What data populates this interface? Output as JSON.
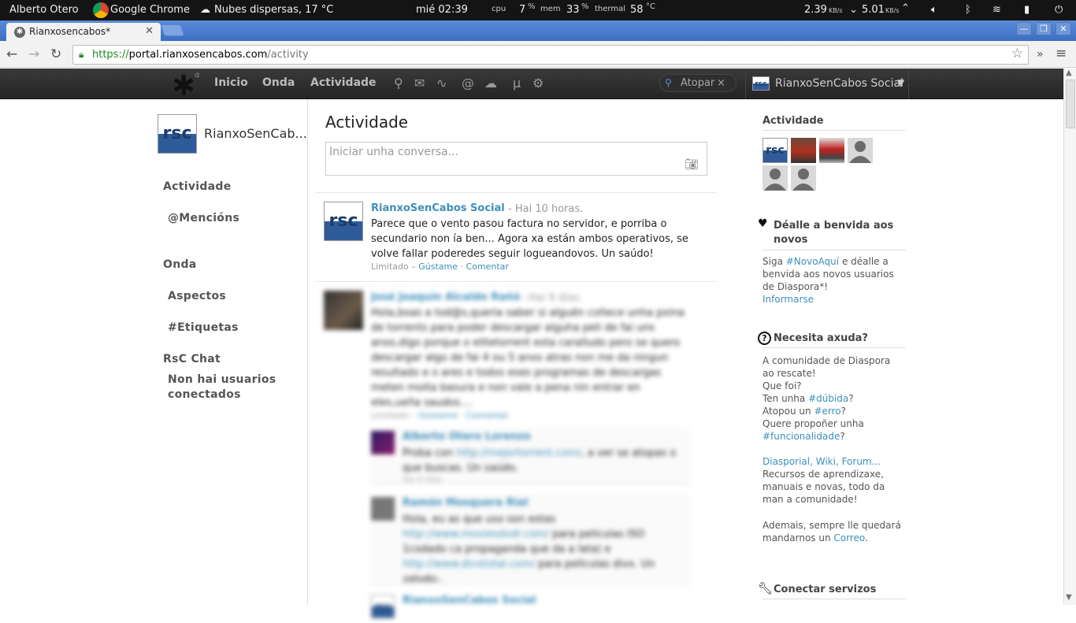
{
  "system_bar": {
    "user": "Alberto Otero",
    "app": "Google Chrome",
    "weather": "Nubes dispersas, 17 °C",
    "datetime": "mié 02:39",
    "cpu_label": "cpu",
    "cpu_value": "7",
    "mem_label": "mem",
    "mem_value": "33",
    "percent": "%",
    "thermal_label": "thermal",
    "thermal_value": "58",
    "celsius": "°C",
    "down_speed": "2.39",
    "up_speed": "5.01",
    "speed_unit": "KB/s"
  },
  "browser": {
    "tab_title": "Rianxosencabos*",
    "url_scheme": "https://",
    "url_host": "portal.rianxosencabos.com",
    "url_path": "/activity"
  },
  "diaspora_nav": {
    "alpha": "α",
    "links": [
      "Inicio",
      "Onda",
      "Actividade"
    ],
    "search_placeholder": "Atopar",
    "user_name": "RianxoSenCabos Social"
  },
  "left": {
    "profile_name": "RianxoSenCab...",
    "actividade": "Actividade",
    "mencions": "@Mencións",
    "onda": "Onda",
    "aspectos": "Aspectos",
    "etiquetas": "#Etiquetas",
    "chat_title": "RsC Chat",
    "chat_empty": "Non hai usuarios conectados"
  },
  "main": {
    "title": "Actividade",
    "publisher_placeholder": "Iniciar unha conversa...",
    "post1": {
      "author": "RianxoSenCabos Social",
      "time": "Hai 10 horas.",
      "text": "Parece que o vento pasou factura no servidor, e porriba o secundario non ía ben... Agora xa están ambos operativos, se volve fallar poderedes seguir logueandovos. Un saúdo!",
      "visibility": "Limitado",
      "like": "Gústame",
      "comment": "Comentar"
    },
    "post2": {
      "author": "José Joaquín Alcalde Rañó",
      "time": "Hai 9 días.",
      "text": "Hola,boas a tod@s,queria saber si alguén coñece unha pxina de torrents para poder descargar alguha peli de fai uns anos,digo porque o elitetorrent esta caralludo pero se quero descargar algo de fai 4 ou 5 anos atras non me da ningun resultado e o ares e todos eses programas de descargas meten moita basura e non vale a pena nin entrar en eles,ueña saudos....",
      "visibility": "Limitado",
      "like": "Gústame",
      "comment": "Comentar"
    },
    "comments": [
      {
        "author": "Alberto Otero Lorenzo",
        "text_before": "Proba con ",
        "link": "http://mejortorrent.com/",
        "text_after": ", a ver se atopas o que buscas. Un saúdo.",
        "time": "Hai 9 días."
      },
      {
        "author": "Ramón Mosquera Rial",
        "text_before": "Hola, eu as que uso son estas ",
        "link": "http://www.moviesdvdr.com/",
        "text_after": " para peliculas ISO 1codado ca propaganda que da a lata) e ",
        "link2": "http://www.divxtotal.com/",
        "text_after2": " para películas divx. Un saludo",
        "time": "Hai 2 días."
      }
    ],
    "comment3_author": "RianxoSenCabos Social"
  },
  "right": {
    "actividade": "Actividade",
    "welcome_title": "Déalle a benvida aos novos",
    "welcome_text1": "Siga ",
    "welcome_tag": "#NovoAquí",
    "welcome_text2": " e déalle a benvida aos novos usuarios de Diaspora*!",
    "welcome_link": "Informarse",
    "help_title": "Necesita axuda?",
    "help_line1": "A comunidade de Diaspora ao rescate!",
    "help_q": "Que foi?",
    "help_doubt_pre": "Ten unha ",
    "help_doubt_tag": "#dúbida",
    "help_err_pre": "Atopou un ",
    "help_err_tag": "#erro",
    "help_feat_pre": "Quere propoñer unha",
    "help_feat_tag": "#funcionalidade",
    "q": "?",
    "res_links": "Diasporial, Wiki, Forum...",
    "res_text": "Recursos de aprendizaxe, manuais e novas, todo da man a comunidade!",
    "mail_text": "Ademais, sempre lle quedará mandarnos un ",
    "mail_link": "Correo",
    "dot": ".",
    "connect_title": "Conectar servizos"
  }
}
